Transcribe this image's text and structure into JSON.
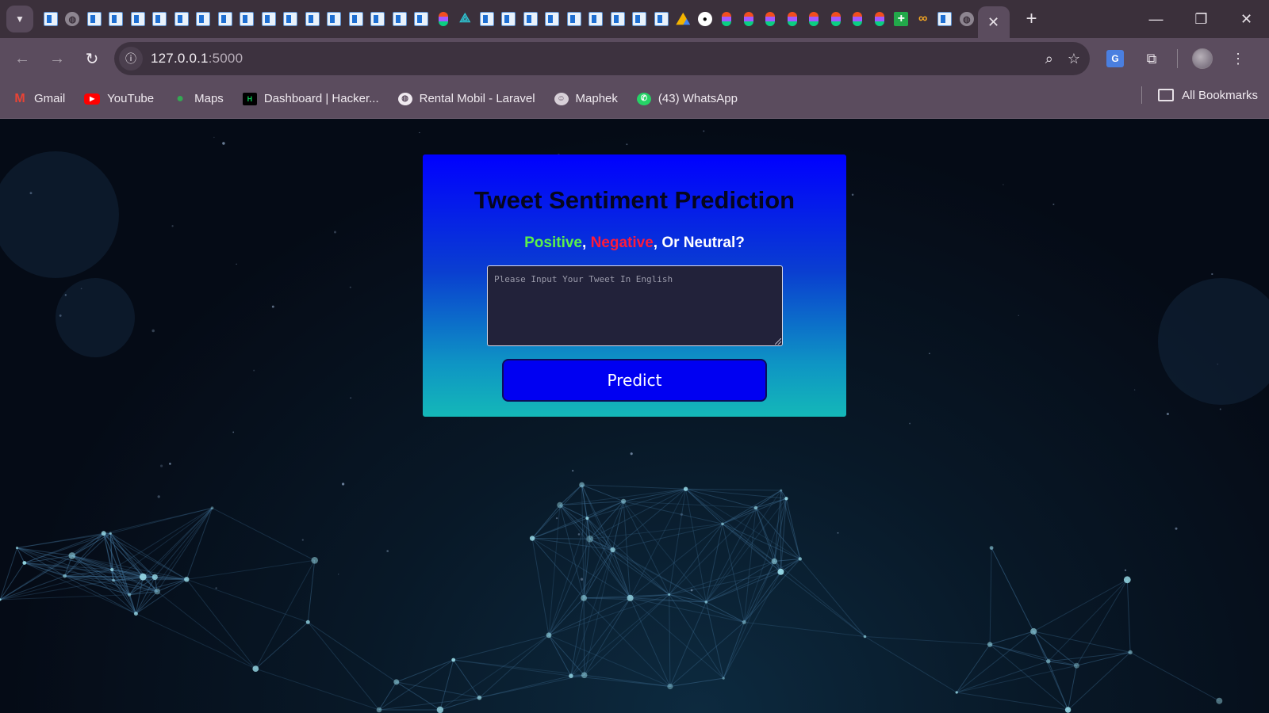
{
  "browser": {
    "tab_search_icon": "chevron-down-icon",
    "pinned_tab_icons": [
      "doc",
      "globe",
      "doc",
      "doc",
      "doc",
      "doc",
      "doc",
      "doc",
      "doc",
      "doc",
      "doc",
      "doc",
      "doc",
      "doc",
      "doc",
      "doc",
      "doc",
      "doc",
      "figma",
      "star",
      "doc",
      "doc",
      "doc",
      "doc",
      "doc",
      "doc",
      "doc",
      "doc",
      "doc",
      "drive",
      "github",
      "figma",
      "figma",
      "figma",
      "figma",
      "figma",
      "figma",
      "figma",
      "figma",
      "plus-green",
      "infinity",
      "doc",
      "globe"
    ],
    "active_tab_close": "✕",
    "new_tab": "+",
    "window_controls": {
      "minimize": "—",
      "restore": "❐",
      "close": "✕"
    },
    "url_host": "127.0.0.1",
    "url_port": ":5000",
    "icons": {
      "zoom": "zoom-icon",
      "bookmark": "star-icon",
      "translate": "google-translate-icon",
      "extensions": "puzzle-icon",
      "profile": "avatar",
      "menu": "kebab-menu-icon"
    }
  },
  "bookmarks": {
    "items": [
      {
        "label": "Gmail",
        "icon": "gmail-icon"
      },
      {
        "label": "YouTube",
        "icon": "youtube-icon"
      },
      {
        "label": "Maps",
        "icon": "maps-icon"
      },
      {
        "label": "Dashboard | Hacker...",
        "icon": "hackerrank-icon"
      },
      {
        "label": "Rental Mobil - Laravel",
        "icon": "globe-icon"
      },
      {
        "label": "Maphek",
        "icon": "maphek-icon"
      },
      {
        "label": "(43) WhatsApp",
        "icon": "whatsapp-icon"
      }
    ],
    "all_bookmarks": "All Bookmarks"
  },
  "page": {
    "title": "Tweet Sentiment Prediction",
    "subtitle": {
      "positive": "Positive",
      "sep1": ",",
      "negative": "Negative",
      "sep2": ",",
      "rest": " Or Neutral?"
    },
    "input_placeholder": "Please Input Your Tweet In English",
    "input_value": "",
    "predict_label": "Predict",
    "colors": {
      "positive": "#5cf04a",
      "negative": "#ff1a3a",
      "card_top": "#0000ff",
      "card_bottom": "#14b8b8",
      "button": "#0000f2"
    }
  }
}
